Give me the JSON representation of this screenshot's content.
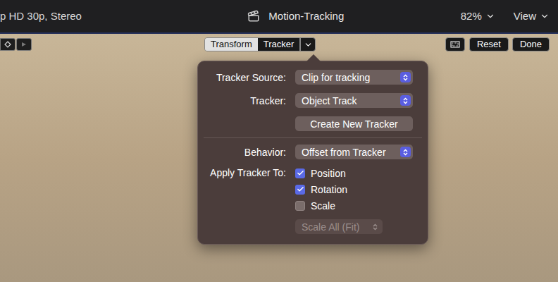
{
  "viewer_header": {
    "format": "p HD 30p, Stereo",
    "title": "Motion-Tracking",
    "zoom": "82%",
    "view_menu": "View"
  },
  "toolbar": {
    "tabs": [
      {
        "label": "Transform",
        "selected": false
      },
      {
        "label": "Tracker",
        "selected": true
      }
    ],
    "buttons": [
      "Reset",
      "Done"
    ]
  },
  "popover": {
    "tracker_source": {
      "label": "Tracker Source:",
      "value": "Clip for tracking"
    },
    "tracker": {
      "label": "Tracker:",
      "value": "Object Track"
    },
    "create_button": "Create New Tracker",
    "behavior": {
      "label": "Behavior:",
      "value": "Offset from Tracker"
    },
    "apply_to": {
      "label": "Apply Tracker To:",
      "options": [
        {
          "label": "Position",
          "checked": true
        },
        {
          "label": "Rotation",
          "checked": true
        },
        {
          "label": "Scale",
          "checked": false
        }
      ]
    },
    "scale_mode": {
      "value": "Scale All (Fit)",
      "disabled": true
    }
  }
}
